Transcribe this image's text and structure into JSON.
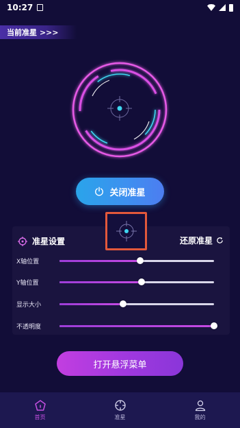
{
  "status_bar": {
    "time": "10:27"
  },
  "header": {
    "current_crosshair_label": "当前准星 >>>"
  },
  "main": {
    "toggle_button_label": "关闭准星"
  },
  "panel": {
    "title": "准星设置",
    "restore_label": "还原准星",
    "sliders": [
      {
        "label": "X轴位置",
        "value": 0.52
      },
      {
        "label": "Y轴位置",
        "value": 0.53
      },
      {
        "label": "显示大小",
        "value": 0.41
      },
      {
        "label": "不透明度",
        "value": 1.0
      }
    ]
  },
  "float_menu_button_label": "打开悬浮菜单",
  "tabbar": {
    "tabs": [
      {
        "label": "首页",
        "icon": "home-pentagon-icon",
        "active": true
      },
      {
        "label": "准星",
        "icon": "crosshair-icon",
        "active": false
      },
      {
        "label": "我的",
        "icon": "user-icon",
        "active": false
      }
    ]
  },
  "colors": {
    "background": "#120d38",
    "accent_pink": "#e65ae6",
    "accent_cyan": "#3fd6f0",
    "button_blue": "#2aa4ea",
    "button_purple": "#a239df",
    "highlight_box": "#e2583b"
  }
}
